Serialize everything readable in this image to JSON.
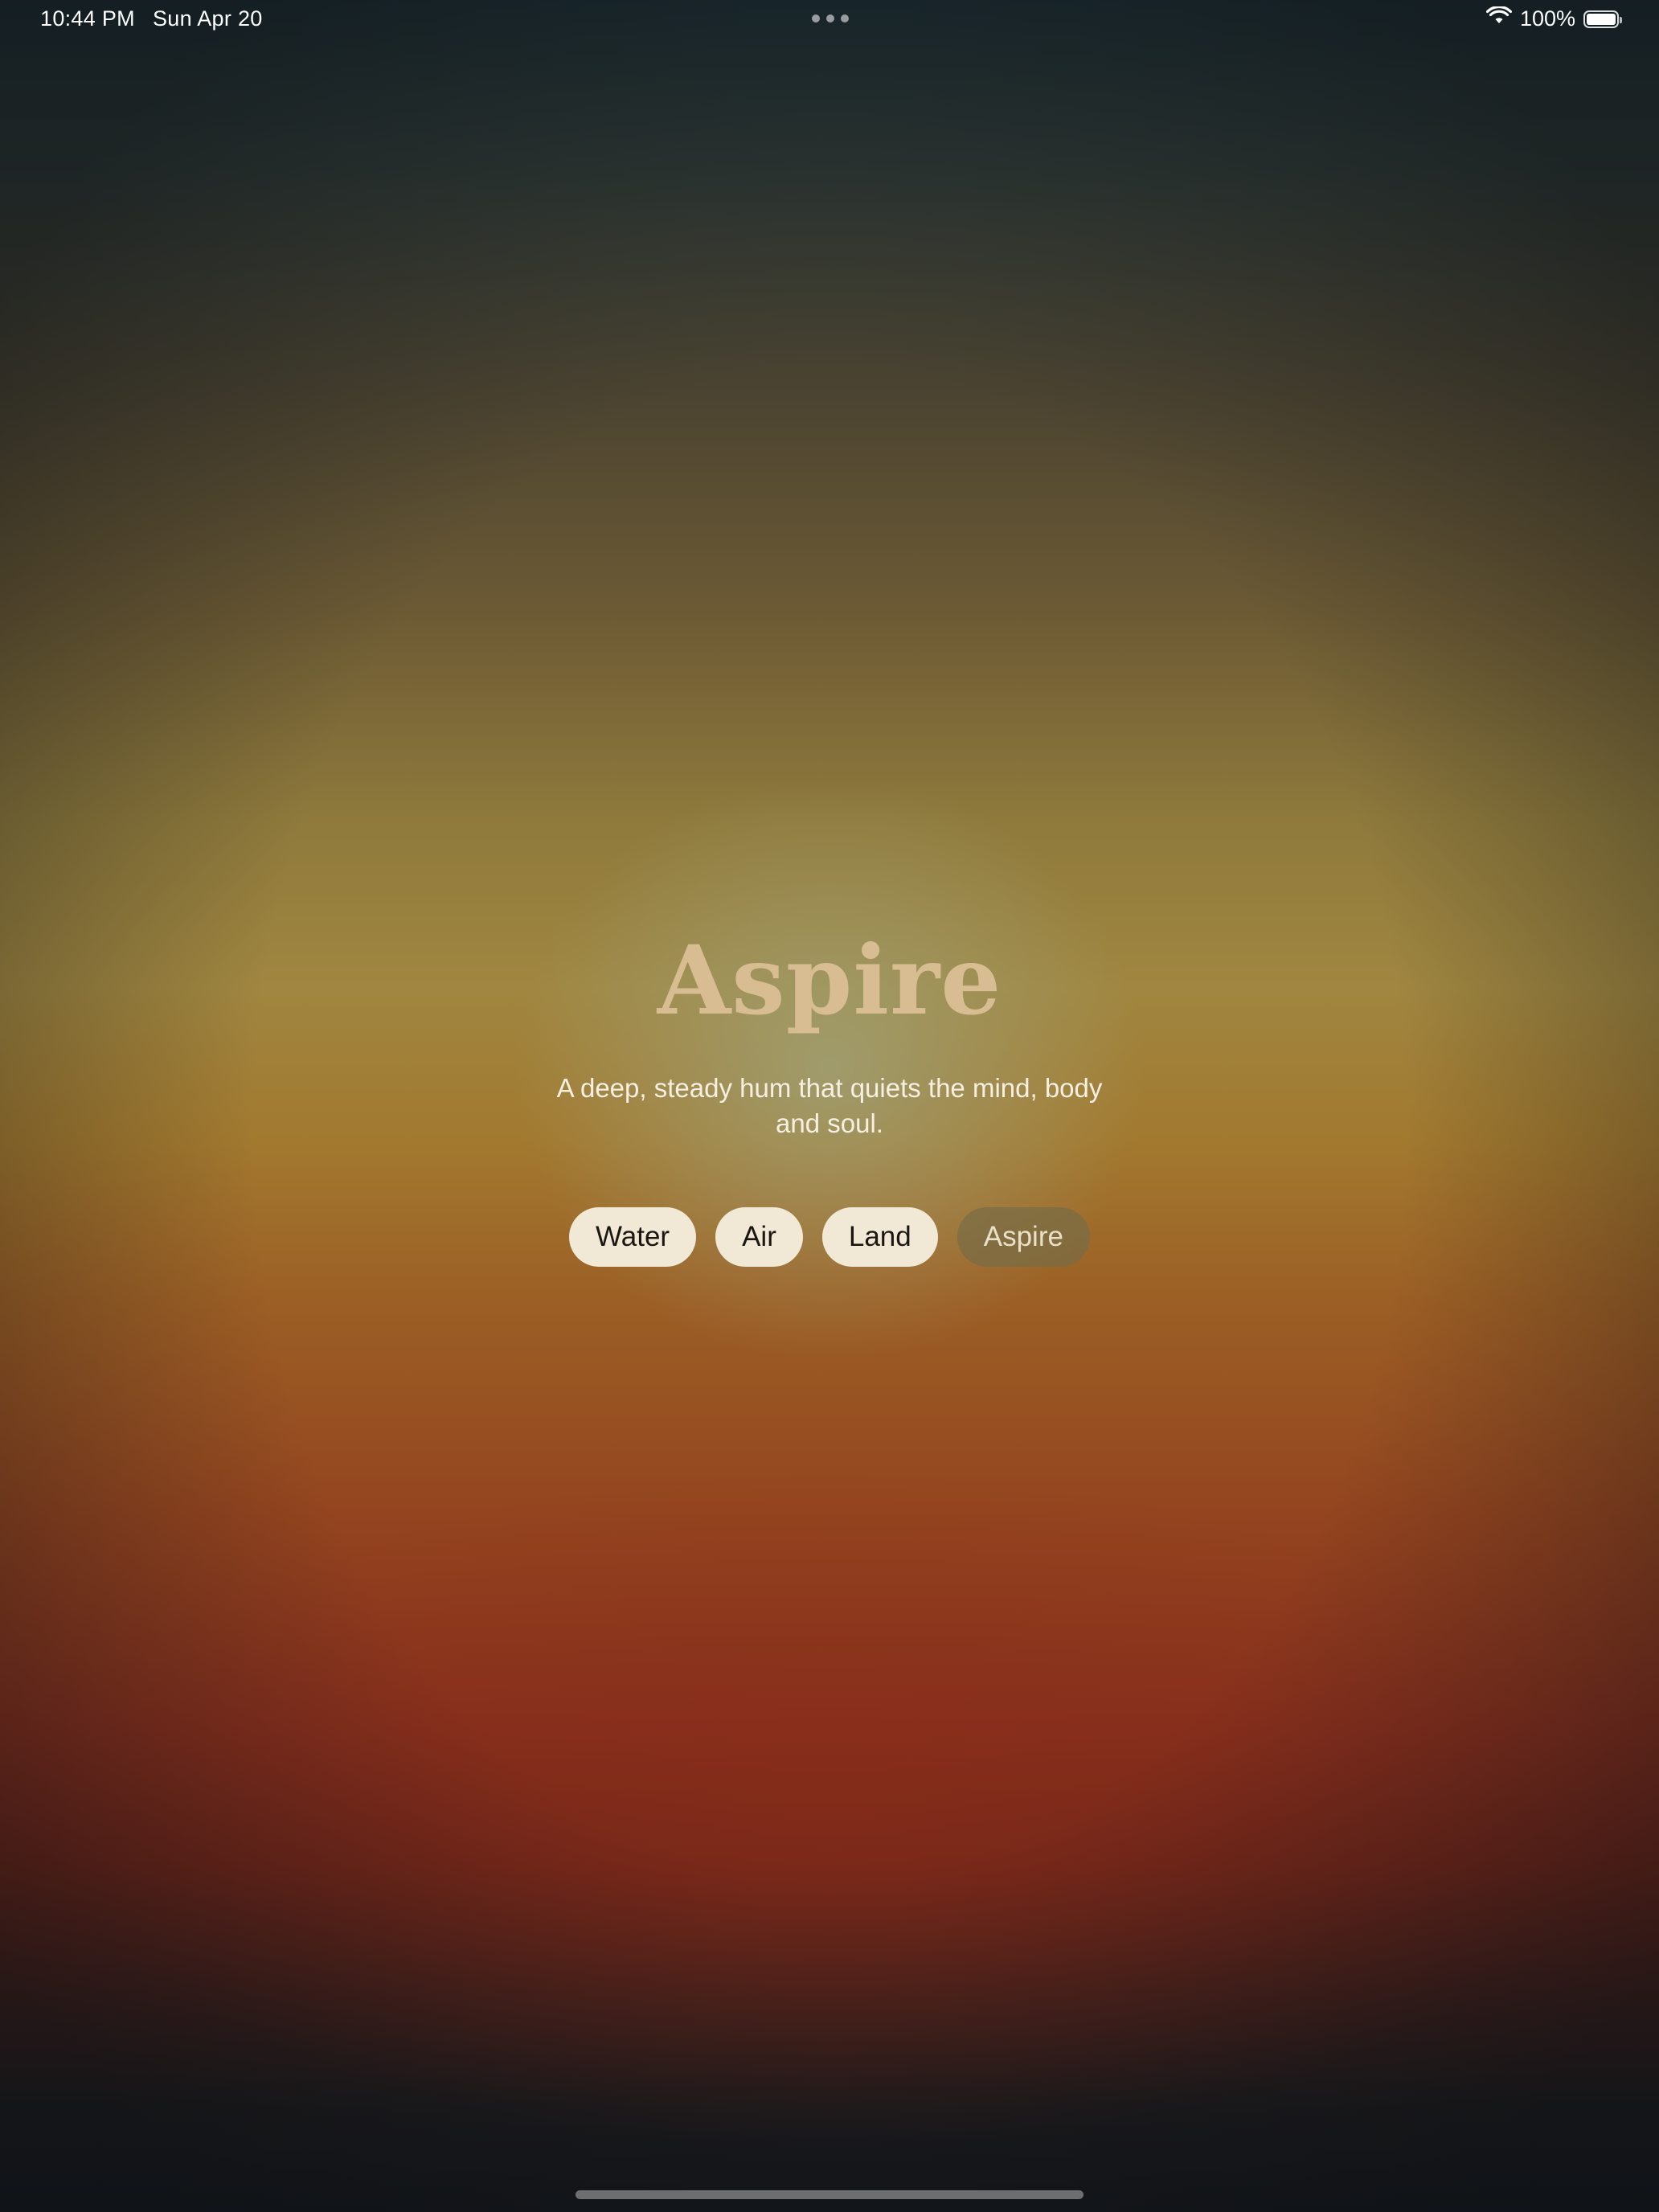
{
  "status_bar": {
    "time": "10:44 PM",
    "date": "Sun Apr 20",
    "battery_percent": "100%",
    "battery_level": 1.0,
    "icons": [
      "wifi-icon",
      "battery-icon",
      "multitask-dots-icon"
    ]
  },
  "main": {
    "title": "Aspire",
    "description": "A deep, steady hum that quiets the mind, body and soul.",
    "chips": [
      {
        "label": "Water",
        "selected": false
      },
      {
        "label": "Air",
        "selected": false
      },
      {
        "label": "Land",
        "selected": false
      },
      {
        "label": "Aspire",
        "selected": true
      }
    ]
  },
  "colors": {
    "title": "#d9bd92",
    "chip_background": "#f1e9d6",
    "chip_selected_background": "#786c46",
    "background_top": "#1c2c31",
    "background_middle": "#a08640",
    "background_lower": "#862f1d",
    "background_bottom": "#14171b"
  }
}
